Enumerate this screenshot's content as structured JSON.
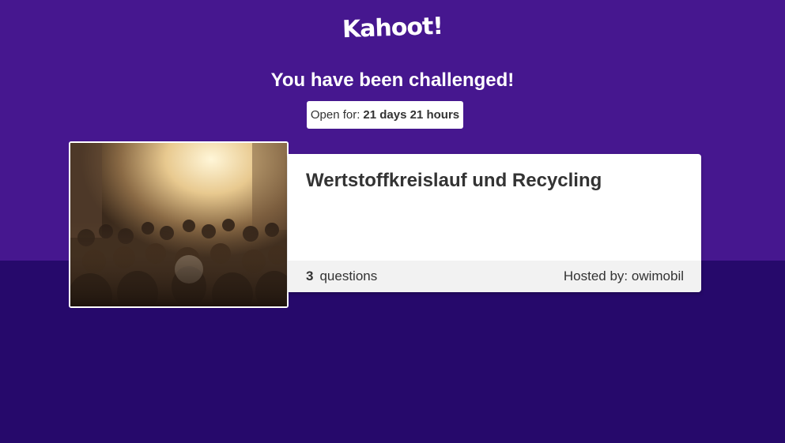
{
  "header": {
    "logo_text": "Kahoot!",
    "headline": "You have been challenged!"
  },
  "timer": {
    "label": "Open for:",
    "value": "21 days 21 hours"
  },
  "quiz": {
    "title": "Wertstoffkreislauf und Recycling",
    "question_count": "3",
    "questions_label": "questions",
    "hosted_by": "Hosted by: owimobil",
    "cover_image": "crowd-photo"
  },
  "colors": {
    "top_band": "#46178f",
    "bottom_band": "#26096b",
    "card": "#ffffff",
    "footer": "#f2f2f2"
  }
}
